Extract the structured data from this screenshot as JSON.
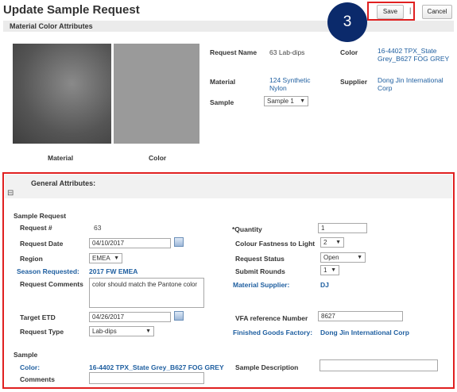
{
  "page": {
    "title": "Update Sample Request"
  },
  "toolbar": {
    "step_badge": "3",
    "save_label": "Save",
    "separator": "|",
    "cancel_label": "Cancel"
  },
  "material_color": {
    "section_title": "Material Color Attributes",
    "material_caption": "Material",
    "color_caption": "Color",
    "request_name_label": "Request Name",
    "request_name_value": "63 Lab-dips",
    "color_label": "Color",
    "color_value": "16-4402 TPX_State Grey_B627 FOG GREY",
    "material_label": "Material",
    "material_value": "124 Synthetic Nylon",
    "supplier_label": "Supplier",
    "supplier_value": "Dong Jin International Corp",
    "sample_label": "Sample",
    "sample_value": "Sample 1",
    "colors": {
      "material_swatch": "#5a5a5a",
      "color_swatch": "#9a9a9a"
    }
  },
  "general": {
    "section_title": "General Attributes:",
    "collapse_symbol": "⊟",
    "sample_request_heading": "Sample Request",
    "request_no_label": "Request #",
    "request_no_value": "63",
    "quantity_label": "*Quantity",
    "quantity_value": "1",
    "request_date_label": "Request Date",
    "request_date_value": "04/10/2017",
    "colour_fastness_label": "Colour Fastness to Light",
    "colour_fastness_value": "2",
    "region_label": "Region",
    "region_value": "EMEA",
    "request_status_label": "Request Status",
    "request_status_value": "Open",
    "season_label": "Season Requested:",
    "season_value": "2017 FW EMEA",
    "submit_rounds_label": "Submit Rounds",
    "submit_rounds_value": "1",
    "comments_label": "Request Comments",
    "comments_value": "color should match the Pantone color",
    "material_supplier_label": "Material Supplier:",
    "material_supplier_value": "DJ",
    "target_etd_label": "Target ETD",
    "target_etd_value": "04/26/2017",
    "vfa_label": "VFA reference Number",
    "vfa_value": "8627",
    "request_type_label": "Request Type",
    "request_type_value": "Lab-dips",
    "fg_factory_label": "Finished Goods Factory:",
    "fg_factory_value": "Dong Jin International Corp",
    "sample_heading": "Sample",
    "sample_color_label": "Color:",
    "sample_color_value": "16-4402 TPX_State Grey_B627 FOG GREY",
    "sample_description_label": "Sample Description",
    "sample_description_value": "",
    "sample_comments_label": "Comments",
    "sample_comments_value": ""
  },
  "colors": {
    "accent_link": "#1f5fa0",
    "highlight_red": "#e02020",
    "badge_navy": "#0b2a6b"
  }
}
